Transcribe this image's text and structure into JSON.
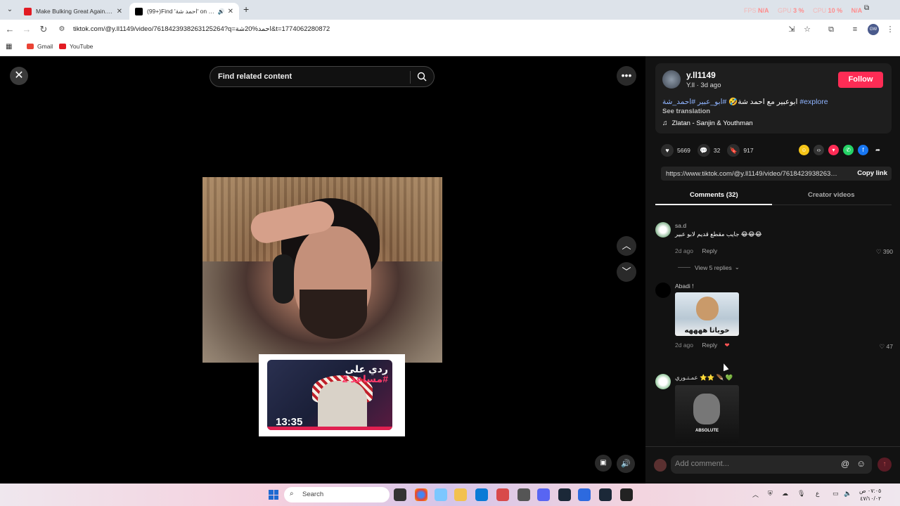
{
  "browser": {
    "tabs": [
      {
        "title": "Make Bulking Great Again... Or",
        "icon": "youtube-icon"
      },
      {
        "title": "(99+)Find 'احمد شة' on TikTok",
        "icon": "tiktok-icon"
      }
    ],
    "perf": {
      "fps_label": "FPS",
      "fps": "N/A",
      "gpu_label": "GPU",
      "gpu": "3 %",
      "cpu_label": "CPU",
      "cpu": "10 %",
      "net": "N/A"
    },
    "url": "tiktok.com/@y.ll1149/video/7618423938263125264?q=احمد%20شة&t=1774062280872",
    "bookmarks": [
      {
        "label": "Gmail",
        "color": "#ea4335"
      },
      {
        "label": "YouTube",
        "color": "#e21b23"
      }
    ]
  },
  "video": {
    "search_placeholder": "Find related content",
    "thumbnail": {
      "title_line1": "ردي على",
      "title_line2": "مساعد 2#",
      "duration": "13:35"
    }
  },
  "author": {
    "username": "y.ll1149",
    "subline": "Y.ll · 3d ago",
    "follow_label": "Follow",
    "description_text": "ابوعبير مع احمد شة🤣",
    "description_tags": "#ابو_عبير #احمد_شة #explore",
    "see_translation": "See translation",
    "music": "Zlatan - Sanjin & Youthman"
  },
  "stats": {
    "likes": "5669",
    "comments": "32",
    "saves": "917"
  },
  "share_link": {
    "url": "https://www.tiktok.com/@y.ll1149/video/7618423938263125264",
    "copy_label": "Copy link"
  },
  "panel_tabs": {
    "comments": "Comments (32)",
    "creator_videos": "Creator videos"
  },
  "comments": [
    {
      "name": "sa.d",
      "text": "جايب مقطع قديم لابو عبير 😂😂😂",
      "time": "2d ago",
      "reply": "Reply",
      "likes": "390",
      "replies": "View 5 replies"
    },
    {
      "name": "Abadi !",
      "text": "",
      "image_caption": "خوياتا ههههه",
      "time": "2d ago",
      "reply": "Reply",
      "likes": "47"
    },
    {
      "name": "عمـتـوري ⭐⭐ 🪶 💚",
      "text": "",
      "image_caption": "ABSOLUTE",
      "time": "",
      "reply": "",
      "likes": ""
    }
  ],
  "add_comment": {
    "placeholder": "Add comment..."
  },
  "taskbar": {
    "search_label": "Search",
    "clock_time": "٠٧:٠٥ ص",
    "clock_date": "٤٧/١٠/٠٢",
    "lang": "ع"
  },
  "colors": {
    "accent": "#fe2c55",
    "link": "#8fb4ff",
    "panel": "#121212"
  }
}
